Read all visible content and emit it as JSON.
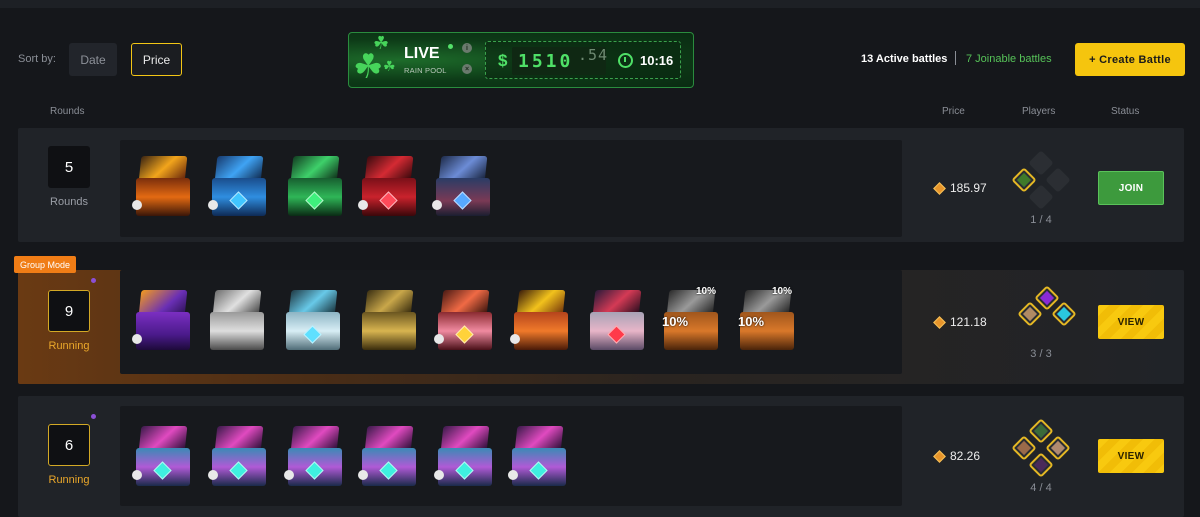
{
  "toolbar": {
    "sort_label": "Sort by:",
    "sort_date": "Date",
    "sort_price": "Price",
    "active_battles": "13 Active battles",
    "joinable_battles": "7 Joinable battles",
    "create_battle": "+ Create Battle"
  },
  "rain": {
    "live": "LIVE",
    "subtitle": "RAIN POOL",
    "info": "i",
    "close": "×",
    "dollar": "$",
    "amount": "1510",
    "cents": ".54",
    "timer": "10:16"
  },
  "columns": {
    "rounds": "Rounds",
    "price": "Price",
    "players": "Players",
    "status": "Status"
  },
  "colors": {
    "accent": "#f5c50e",
    "join": "#3d9a3d",
    "live_green": "#4fe067",
    "group_mode": "#f07d16",
    "running": "#eaa72a"
  },
  "battles": [
    {
      "rounds": "5",
      "round_label": "Rounds",
      "price": "185.97",
      "players": "1 / 4",
      "status": "JOIN",
      "cases": [
        "fire-case",
        "ice-case",
        "jade-case",
        "red-case",
        "blue-case"
      ]
    },
    {
      "group_badge": "Group Mode",
      "rounds": "9",
      "round_label": "Running",
      "price": "121.18",
      "players": "3 / 3",
      "status": "VIEW",
      "cases": [
        "purple-fruit-case",
        "silver-case",
        "frost-case",
        "gold-case",
        "pink-case",
        "explosion-case",
        "red-pink-case",
        "discount-case",
        "discount-case"
      ],
      "discount_tag": "10%"
    },
    {
      "rounds": "6",
      "round_label": "Running",
      "price": "82.26",
      "players": "4 / 4",
      "status": "VIEW",
      "cases": [
        "neon-case",
        "neon-case",
        "neon-case",
        "neon-case",
        "neon-case",
        "neon-case"
      ]
    }
  ]
}
